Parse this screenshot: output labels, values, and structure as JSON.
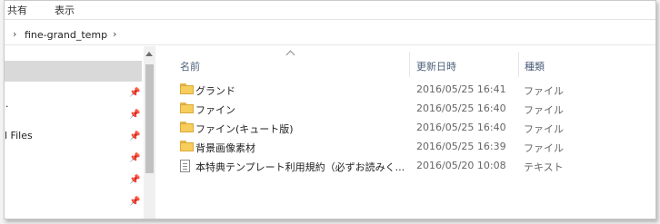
{
  "ribbon": {
    "tab1": "共有",
    "tab2": "表示"
  },
  "address": {
    "crumb": "fine-grand_temp",
    "chevron_left": "›",
    "chevron_right": "›"
  },
  "nav": {
    "partial_item": "l Files",
    "dot": "·",
    "pin_glyph": "📌"
  },
  "columns": {
    "name": "名前",
    "date": "更新日時",
    "type": "種類"
  },
  "files": [
    {
      "icon": "folder",
      "name": "グランド",
      "date": "2016/05/25 16:41",
      "type": "ファイル"
    },
    {
      "icon": "folder",
      "name": "ファイン",
      "date": "2016/05/25 16:40",
      "type": "ファイル"
    },
    {
      "icon": "folder",
      "name": "ファイン(キュート版)",
      "date": "2016/05/25 16:40",
      "type": "ファイル"
    },
    {
      "icon": "folder",
      "name": "背景画像素材",
      "date": "2016/05/25 16:39",
      "type": "ファイル"
    },
    {
      "icon": "text-file",
      "name": "本特典テンプレート利用規約（必ずお読みく...",
      "date": "2016/05/20 10:08",
      "type": "テキスト"
    }
  ]
}
